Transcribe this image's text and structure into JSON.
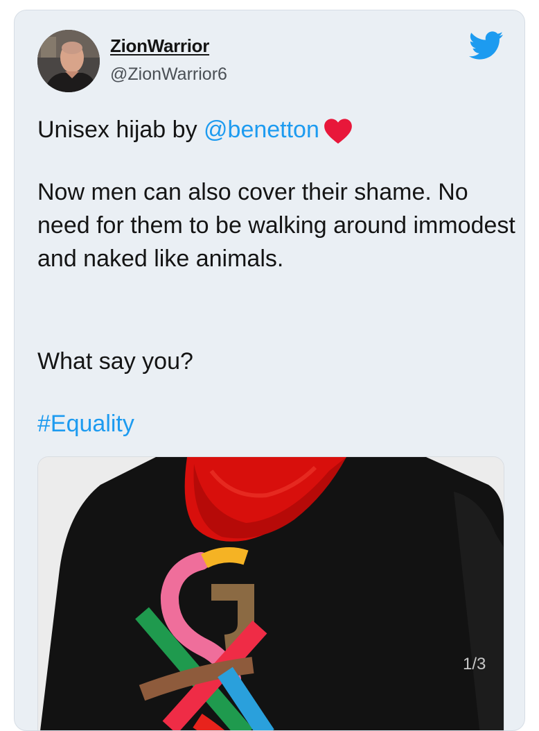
{
  "tweet": {
    "display_name": "ZionWarrior",
    "handle": "@ZionWarrior6",
    "line1_text": "Unisex hijab by ",
    "line1_mention": "@benetton",
    "para2": "Now men can also cover their shame. No need for them to be walking around immodest and naked like animals.",
    "para3": "What say you?",
    "hashtag": "#Equality"
  },
  "media": {
    "counter": "1/3"
  },
  "icons": {
    "logo": "twitter-bird-icon",
    "heart": "red-heart-icon"
  },
  "colors": {
    "link": "#1d9bf0",
    "card_bg": "#eaeff4",
    "heart": "#e8173a",
    "hijab": "#e0110e"
  }
}
